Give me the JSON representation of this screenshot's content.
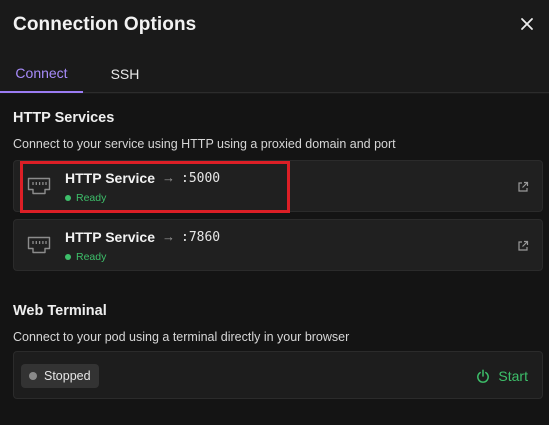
{
  "dialog": {
    "title": "Connection Options",
    "close_icon": "close-icon"
  },
  "tabs": [
    {
      "label": "Connect",
      "active": true
    },
    {
      "label": "SSH",
      "active": false
    }
  ],
  "http_services": {
    "title": "HTTP Services",
    "description": "Connect to your service using HTTP using a proxied domain and port",
    "services": [
      {
        "name": "HTTP Service",
        "arrow": "→",
        "port": ":5000",
        "status": "Ready",
        "icon": "ethernet-port-icon",
        "link_icon": "external-link-icon"
      },
      {
        "name": "HTTP Service",
        "arrow": "→",
        "port": ":7860",
        "status": "Ready",
        "icon": "ethernet-port-icon",
        "link_icon": "external-link-icon"
      }
    ]
  },
  "web_terminal": {
    "title": "Web Terminal",
    "description": "Connect to your pod using a terminal directly in your browser",
    "status": "Stopped",
    "start_label": "Start",
    "start_icon": "power-icon"
  },
  "colors": {
    "accent": "#9b7cf4",
    "ready": "#3dbf6a",
    "highlight": "#dc1f26"
  }
}
